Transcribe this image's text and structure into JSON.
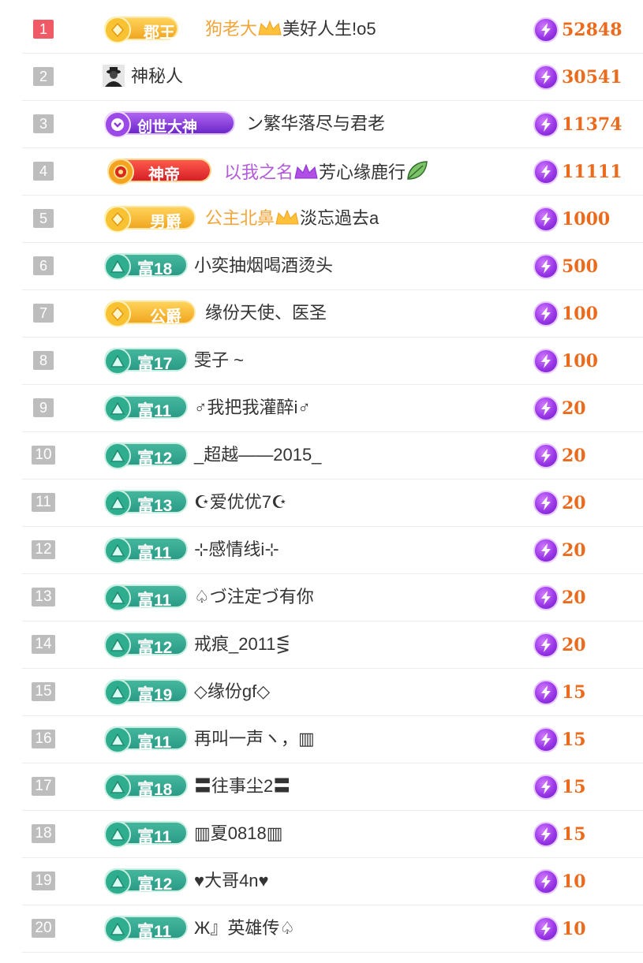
{
  "colors": {
    "rank_top": "#ef5a66",
    "rank_default": "#bdbdbd",
    "score": "#ec6a1c",
    "rich_badge": "#2fae8f",
    "gold_badge": "#f5b22a",
    "name_gold": "#f1a63a",
    "name_purple": "#b25ad8"
  },
  "rows": [
    {
      "rank": "1",
      "badge": {
        "type": "gold",
        "icon": "gem-icon",
        "label": "郡王"
      },
      "name_prefix": "狗老大",
      "name_suffix": "美好人生!o5",
      "crown": "gold-crown-icon",
      "score_icon": "lightning-icon",
      "score": "52848"
    },
    {
      "rank": "2",
      "badge": null,
      "avatar": "mystery-person-icon",
      "name": "神秘人",
      "score_icon": "lightning-icon",
      "score": "30541"
    },
    {
      "rank": "3",
      "badge": {
        "type": "purple",
        "icon": "chevron-icon",
        "label": "创世大神"
      },
      "name": "ン繁华落尽与君老",
      "score_icon": "lightning-icon",
      "score": "11374"
    },
    {
      "rank": "4",
      "badge": {
        "type": "red",
        "icon": "medal-icon",
        "label": "神帝"
      },
      "name_prefix": "以我之名",
      "name_suffix": "芳心缘鹿行",
      "crown": "purple-crown-icon",
      "trailing_icon": "leaf-icon",
      "score_icon": "lightning-icon",
      "score": "11111"
    },
    {
      "rank": "5",
      "badge": {
        "type": "gold",
        "icon": "gem-icon",
        "label": "男爵"
      },
      "name_prefix": "公主北鼻",
      "name_suffix": "淡忘過去a",
      "crown": "gold-crown-icon",
      "score_icon": "lightning-icon",
      "score": "1000"
    },
    {
      "rank": "6",
      "badge": {
        "type": "rich",
        "icon": "triangle-gem-icon",
        "label": "富18"
      },
      "name": "小奕抽烟喝酒烫头",
      "score_icon": "lightning-icon",
      "score": "500"
    },
    {
      "rank": "7",
      "badge": {
        "type": "gold",
        "icon": "gem-icon",
        "label": "公爵"
      },
      "name": "缘份天使、医圣",
      "score_icon": "lightning-icon",
      "score": "100"
    },
    {
      "rank": "8",
      "badge": {
        "type": "rich",
        "icon": "triangle-gem-icon",
        "label": "富17"
      },
      "name": "雯子 ~",
      "score_icon": "lightning-icon",
      "score": "100"
    },
    {
      "rank": "9",
      "badge": {
        "type": "rich",
        "icon": "triangle-gem-icon",
        "label": "富11"
      },
      "name": "♂我把我灌醉i♂",
      "score_icon": "lightning-icon",
      "score": "20"
    },
    {
      "rank": "10",
      "badge": {
        "type": "rich",
        "icon": "triangle-gem-icon",
        "label": "富12"
      },
      "name": "_超越——2015_",
      "score_icon": "lightning-icon",
      "score": "20"
    },
    {
      "rank": "11",
      "badge": {
        "type": "rich",
        "icon": "triangle-gem-icon",
        "label": "富13"
      },
      "name": "☪爱优优7☪",
      "score_icon": "lightning-icon",
      "score": "20"
    },
    {
      "rank": "12",
      "badge": {
        "type": "rich",
        "icon": "triangle-gem-icon",
        "label": "富11"
      },
      "name": "⊹感情线i⊹",
      "score_icon": "lightning-icon",
      "score": "20"
    },
    {
      "rank": "13",
      "badge": {
        "type": "rich",
        "icon": "triangle-gem-icon",
        "label": "富11"
      },
      "name": "♤づ注定づ有你",
      "score_icon": "lightning-icon",
      "score": "20"
    },
    {
      "rank": "14",
      "badge": {
        "type": "rich",
        "icon": "triangle-gem-icon",
        "label": "富12"
      },
      "name": "戒痕_2011⋚",
      "score_icon": "lightning-icon",
      "score": "20"
    },
    {
      "rank": "15",
      "badge": {
        "type": "rich",
        "icon": "triangle-gem-icon",
        "label": "富19"
      },
      "name": "◇缘份gf◇",
      "score_icon": "lightning-icon",
      "score": "15"
    },
    {
      "rank": "16",
      "badge": {
        "type": "rich",
        "icon": "triangle-gem-icon",
        "label": "富11"
      },
      "name": "再叫一声ヽ，▥",
      "score_icon": "lightning-icon",
      "score": "15"
    },
    {
      "rank": "17",
      "badge": {
        "type": "rich",
        "icon": "triangle-gem-icon",
        "label": "富18"
      },
      "name": "〓往事尘2〓",
      "score_icon": "lightning-icon",
      "score": "15"
    },
    {
      "rank": "18",
      "badge": {
        "type": "rich",
        "icon": "triangle-gem-icon",
        "label": "富11"
      },
      "name": "▥夏0818▥",
      "score_icon": "lightning-icon",
      "score": "15"
    },
    {
      "rank": "19",
      "badge": {
        "type": "rich",
        "icon": "triangle-gem-icon",
        "label": "富12"
      },
      "name": "♥大哥4n♥",
      "score_icon": "lightning-icon",
      "score": "10"
    },
    {
      "rank": "20",
      "badge": {
        "type": "rich",
        "icon": "triangle-gem-icon",
        "label": "富11"
      },
      "name": "Ж』英雄传♤",
      "score_icon": "lightning-icon",
      "score": "10"
    }
  ]
}
